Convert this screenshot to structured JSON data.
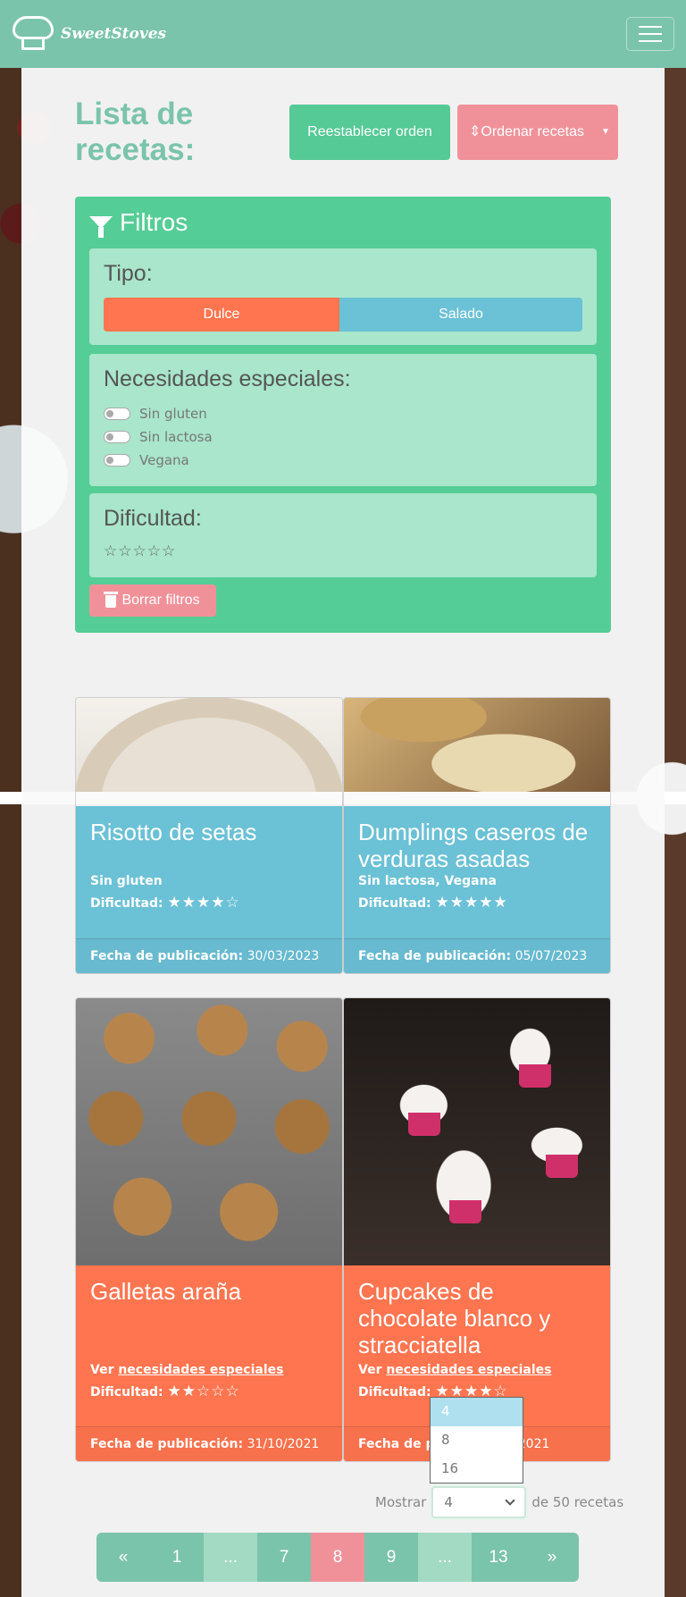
{
  "navbar": {
    "brand": "SweetStoves"
  },
  "page": {
    "title": "Lista de recetas:"
  },
  "buttons": {
    "reset": "Reestablecer orden",
    "order": "Ordenar recetas",
    "clear": "Borrar filtros"
  },
  "filters": {
    "title": "Filtros",
    "tipo": {
      "label": "Tipo:",
      "options": [
        "Dulce",
        "Salado"
      ]
    },
    "necesidades": {
      "label": "Necesidades especiales:",
      "options": [
        "Sin gluten",
        "Sin lactosa",
        "Vegana"
      ]
    },
    "dificultad": {
      "label": "Dificultad:",
      "stars": "☆☆☆☆☆"
    }
  },
  "cards": [
    {
      "title": "Risotto de setas",
      "needs": "Sin gluten",
      "difficulty_label": "Dificultad:",
      "stars": "★★★★☆",
      "date_label": "Fecha de publicación:",
      "date": "30/03/2023"
    },
    {
      "title": "Dumplings caseros de verduras asadas",
      "needs": "Sin lactosa, Vegana",
      "difficulty_label": "Dificultad:",
      "stars": "★★★★★",
      "date_label": "Fecha de publicación:",
      "date": "05/07/2023"
    },
    {
      "title": "Galletas araña",
      "needs_prefix": "Ver",
      "needs_link": "necesidades especiales",
      "difficulty_label": "Dificultad:",
      "stars": "★★☆☆☆",
      "date_label": "Fecha de publicación:",
      "date": "31/10/2021"
    },
    {
      "title": "Cupcakes de chocolate blanco y stracciatella",
      "needs_prefix": "Ver",
      "needs_link": "necesidades especiales",
      "difficulty_label": "Dificultad:",
      "stars": "★★★★☆",
      "date_label": "Fecha de p",
      "date": "/12/2021"
    }
  ],
  "page_size": {
    "options": [
      "4",
      "8",
      "16"
    ],
    "selected": "4",
    "prefix": "Mostrar",
    "suffix": "de 50 recetas"
  },
  "pagination": [
    "«",
    "1",
    "...",
    "7",
    "8",
    "9",
    "...",
    "13",
    "»"
  ],
  "colors": {
    "primary": "#7ac4ab",
    "green": "#55c996",
    "pink": "#f0919a",
    "blue": "#6bc1d6",
    "orange": "#ff7550"
  }
}
